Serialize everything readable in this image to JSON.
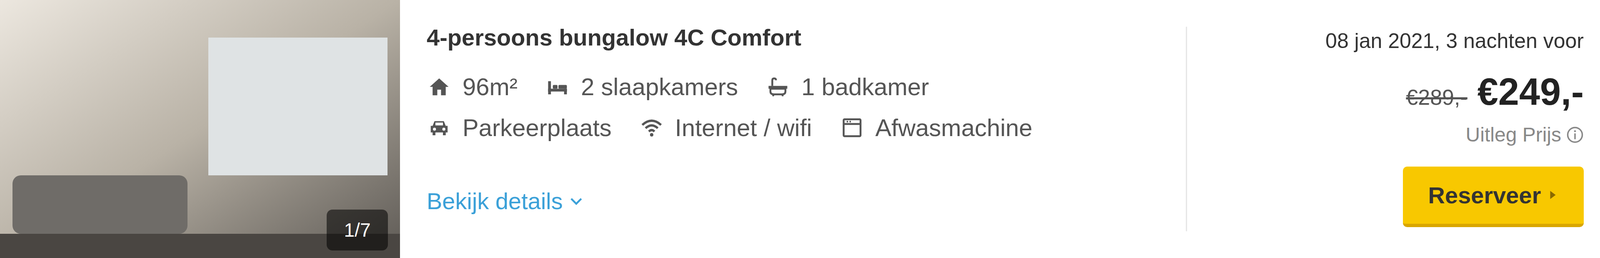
{
  "listing": {
    "photo": {
      "counter": "1/7"
    },
    "title": "4-persoons bungalow 4C Comfort",
    "features": [
      {
        "kind": "area",
        "label": "96m²"
      },
      {
        "kind": "bedrooms",
        "label": "2 slaapkamers"
      },
      {
        "kind": "bathrooms",
        "label": "1 badkamer"
      },
      {
        "kind": "parking",
        "label": "Parkeerplaats"
      },
      {
        "kind": "wifi",
        "label": "Internet / wifi"
      },
      {
        "kind": "dishwasher",
        "label": "Afwasmachine"
      }
    ],
    "details_link": "Bekijk details",
    "date": "08 jan 2021, 3 nachten voor",
    "old_price": "€289,-",
    "price": "€249,-",
    "price_info": "Uitleg Prijs",
    "button": "Reserveer"
  }
}
